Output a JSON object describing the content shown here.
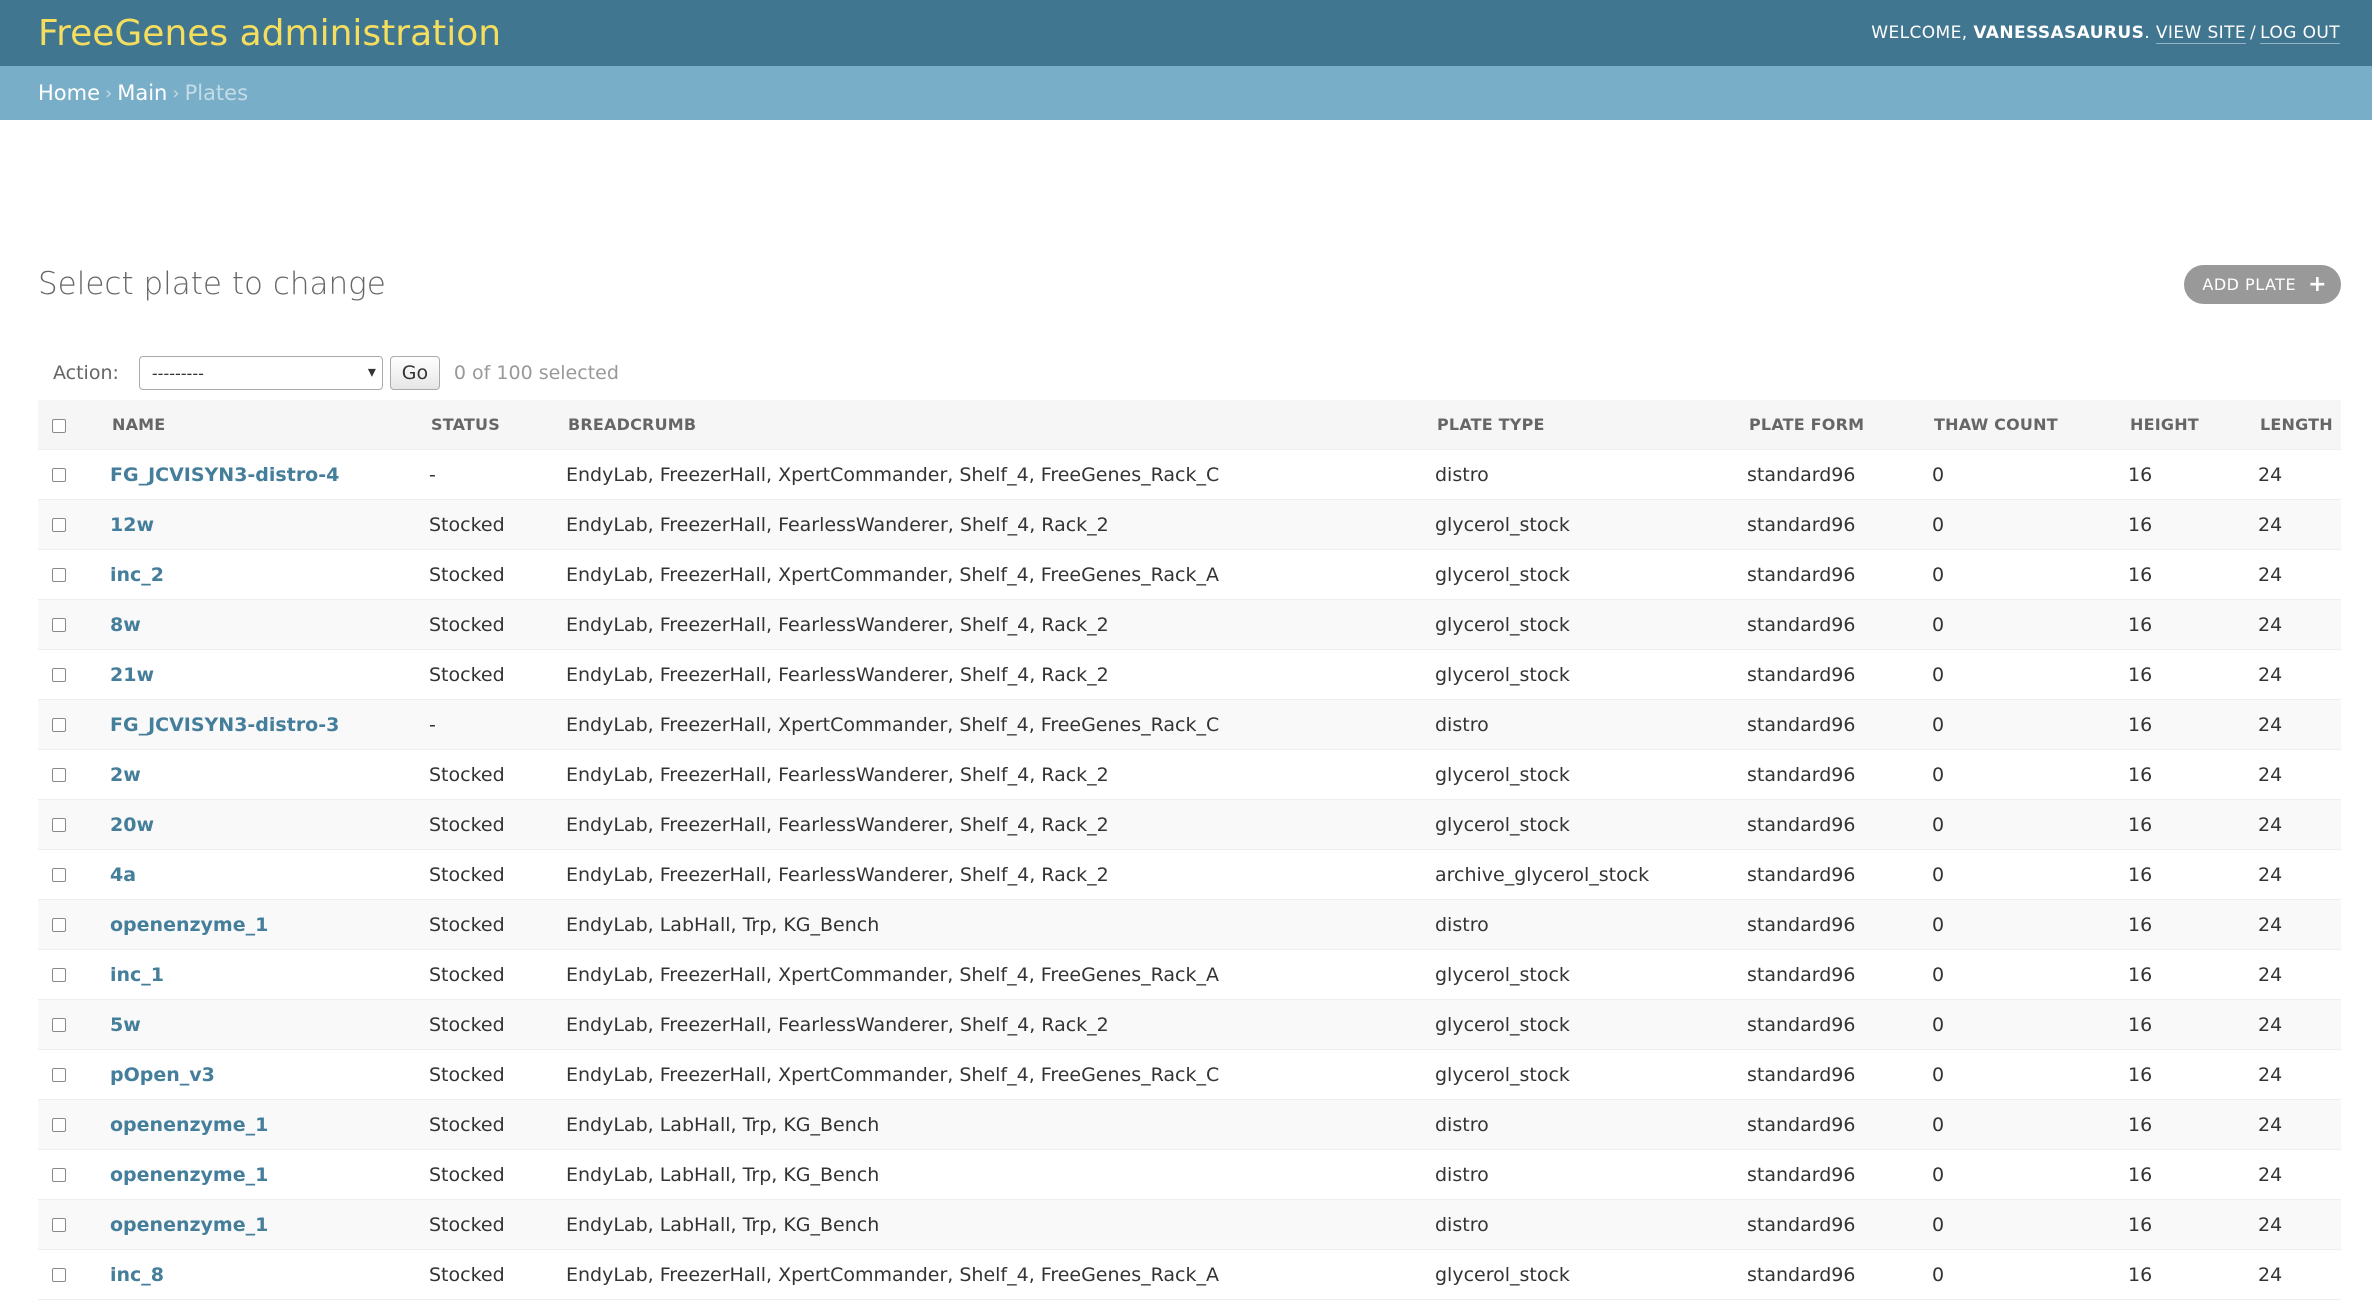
{
  "header": {
    "site_title": "FreeGenes administration",
    "welcome": "Welcome,",
    "username": "vanessasaurus",
    "view_site": "View site",
    "separator": "/",
    "log_out": "Log out"
  },
  "breadcrumbs": {
    "home": "Home",
    "main": "Main",
    "current": "Plates",
    "arrow": "›"
  },
  "page": {
    "title": "Select plate to change",
    "add_button": "Add plate"
  },
  "actions": {
    "label": "Action:",
    "selected": "---------",
    "go": "Go",
    "selection_count": "0 of 100 selected"
  },
  "table": {
    "columns": [
      "Name",
      "Status",
      "Breadcrumb",
      "Plate type",
      "Plate form",
      "Thaw count",
      "Height",
      "Length"
    ],
    "rows": [
      [
        "FG_JCVISYN3-distro-4",
        "-",
        "EndyLab, FreezerHall, XpertCommander, Shelf_4, FreeGenes_Rack_C",
        "distro",
        "standard96",
        "0",
        "16",
        "24"
      ],
      [
        "12w",
        "Stocked",
        "EndyLab, FreezerHall, FearlessWanderer, Shelf_4, Rack_2",
        "glycerol_stock",
        "standard96",
        "0",
        "16",
        "24"
      ],
      [
        "inc_2",
        "Stocked",
        "EndyLab, FreezerHall, XpertCommander, Shelf_4, FreeGenes_Rack_A",
        "glycerol_stock",
        "standard96",
        "0",
        "16",
        "24"
      ],
      [
        "8w",
        "Stocked",
        "EndyLab, FreezerHall, FearlessWanderer, Shelf_4, Rack_2",
        "glycerol_stock",
        "standard96",
        "0",
        "16",
        "24"
      ],
      [
        "21w",
        "Stocked",
        "EndyLab, FreezerHall, FearlessWanderer, Shelf_4, Rack_2",
        "glycerol_stock",
        "standard96",
        "0",
        "16",
        "24"
      ],
      [
        "FG_JCVISYN3-distro-3",
        "-",
        "EndyLab, FreezerHall, XpertCommander, Shelf_4, FreeGenes_Rack_C",
        "distro",
        "standard96",
        "0",
        "16",
        "24"
      ],
      [
        "2w",
        "Stocked",
        "EndyLab, FreezerHall, FearlessWanderer, Shelf_4, Rack_2",
        "glycerol_stock",
        "standard96",
        "0",
        "16",
        "24"
      ],
      [
        "20w",
        "Stocked",
        "EndyLab, FreezerHall, FearlessWanderer, Shelf_4, Rack_2",
        "glycerol_stock",
        "standard96",
        "0",
        "16",
        "24"
      ],
      [
        "4a",
        "Stocked",
        "EndyLab, FreezerHall, FearlessWanderer, Shelf_4, Rack_2",
        "archive_glycerol_stock",
        "standard96",
        "0",
        "16",
        "24"
      ],
      [
        "openenzyme_1",
        "Stocked",
        "EndyLab, LabHall, Trp, KG_Bench",
        "distro",
        "standard96",
        "0",
        "16",
        "24"
      ],
      [
        "inc_1",
        "Stocked",
        "EndyLab, FreezerHall, XpertCommander, Shelf_4, FreeGenes_Rack_A",
        "glycerol_stock",
        "standard96",
        "0",
        "16",
        "24"
      ],
      [
        "5w",
        "Stocked",
        "EndyLab, FreezerHall, FearlessWanderer, Shelf_4, Rack_2",
        "glycerol_stock",
        "standard96",
        "0",
        "16",
        "24"
      ],
      [
        "pOpen_v3",
        "Stocked",
        "EndyLab, FreezerHall, XpertCommander, Shelf_4, FreeGenes_Rack_C",
        "glycerol_stock",
        "standard96",
        "0",
        "16",
        "24"
      ],
      [
        "openenzyme_1",
        "Stocked",
        "EndyLab, LabHall, Trp, KG_Bench",
        "distro",
        "standard96",
        "0",
        "16",
        "24"
      ],
      [
        "openenzyme_1",
        "Stocked",
        "EndyLab, LabHall, Trp, KG_Bench",
        "distro",
        "standard96",
        "0",
        "16",
        "24"
      ],
      [
        "openenzyme_1",
        "Stocked",
        "EndyLab, LabHall, Trp, KG_Bench",
        "distro",
        "standard96",
        "0",
        "16",
        "24"
      ],
      [
        "inc_8",
        "Stocked",
        "EndyLab, FreezerHall, XpertCommander, Shelf_4, FreeGenes_Rack_A",
        "glycerol_stock",
        "standard96",
        "0",
        "16",
        "24"
      ]
    ]
  },
  "colors": {
    "header_bg": "#417690",
    "brand_text": "#f5dd5d",
    "breadcrumb_bg": "#79aec8",
    "link": "#447e9b",
    "add_button_bg": "#999999"
  },
  "icons": {
    "add": "plus-icon",
    "select": "caret-down-icon",
    "checkbox": "checkbox-icon"
  }
}
